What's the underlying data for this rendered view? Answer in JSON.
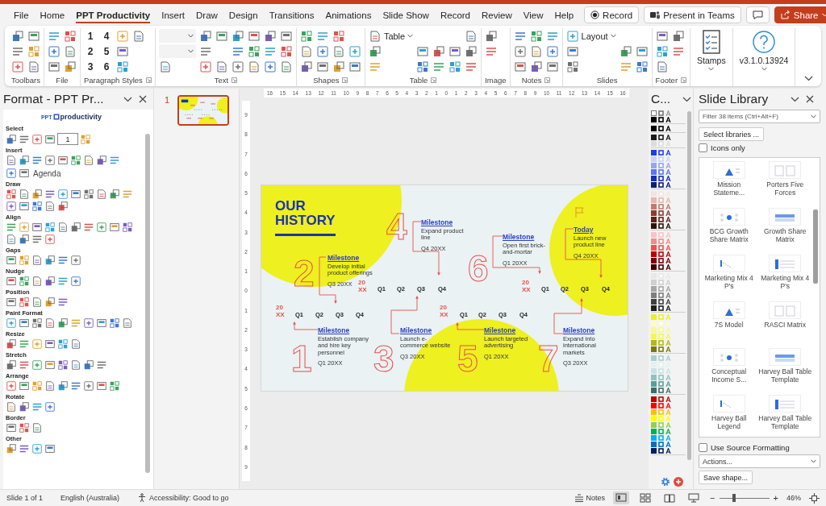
{
  "menu": {
    "tabs": [
      {
        "label": "File",
        "selected": false
      },
      {
        "label": "Home",
        "selected": false
      },
      {
        "label": "PPT Productivity",
        "selected": true
      },
      {
        "label": "Insert",
        "selected": false
      },
      {
        "label": "Draw",
        "selected": false
      },
      {
        "label": "Design",
        "selected": false
      },
      {
        "label": "Transitions",
        "selected": false
      },
      {
        "label": "Animations",
        "selected": false
      },
      {
        "label": "Slide Show",
        "selected": false
      },
      {
        "label": "Record",
        "selected": false
      },
      {
        "label": "Review",
        "selected": false
      },
      {
        "label": "View",
        "selected": false
      },
      {
        "label": "Help",
        "selected": false
      }
    ],
    "record": "Record",
    "present": "Present in Teams",
    "share": "Share"
  },
  "ribbon": {
    "groups": [
      {
        "label": "Toolbars",
        "launcher": false
      },
      {
        "label": "File",
        "launcher": false
      },
      {
        "label": "Paragraph Styles",
        "launcher": true,
        "texts": [
          "1",
          "2",
          "3",
          "4",
          "5",
          "6"
        ]
      },
      {
        "label": "Text",
        "launcher": true
      },
      {
        "label": "Shapes",
        "launcher": true
      },
      {
        "label": "Table",
        "launcher": true,
        "texts": [
          "Table"
        ]
      },
      {
        "label": "Image",
        "launcher": false
      },
      {
        "label": "Notes",
        "launcher": true
      },
      {
        "label": "Slides",
        "launcher": false,
        "texts": [
          "Layout"
        ]
      },
      {
        "label": "Footer",
        "launcher": true
      }
    ],
    "big_buttons": [
      {
        "label": "Stamps"
      },
      {
        "label": "v3.1.0.13924"
      }
    ]
  },
  "format_pane": {
    "title": "Format - PPT Pr...",
    "logo_badge": "PPT",
    "logo_text": "productivity",
    "sections": [
      {
        "title": "Select",
        "field": "1"
      },
      {
        "title": "Insert",
        "label": "Agenda"
      },
      {
        "title": "Draw"
      },
      {
        "title": "Align"
      },
      {
        "title": "Gaps"
      },
      {
        "title": "Nudge"
      },
      {
        "title": "Position"
      },
      {
        "title": "Paint Format"
      },
      {
        "title": "Resize"
      },
      {
        "title": "Stretch"
      },
      {
        "title": "Arrange"
      },
      {
        "title": "Rotate"
      },
      {
        "title": "Border"
      },
      {
        "title": "Other"
      }
    ]
  },
  "thumbnails": [
    {
      "number": "1",
      "selected": true
    }
  ],
  "rulers": {
    "horizontal": [
      "16",
      "15",
      "14",
      "13",
      "12",
      "11",
      "10",
      "9",
      "8",
      "7",
      "6",
      "5",
      "4",
      "3",
      "2",
      "1",
      "0",
      "1",
      "2",
      "3",
      "4",
      "5",
      "6",
      "7",
      "8",
      "9",
      "10",
      "11",
      "12",
      "13",
      "14",
      "15",
      "16"
    ],
    "vertical": [
      "9",
      "8",
      "7",
      "6",
      "5",
      "4",
      "3",
      "2",
      "1",
      "0",
      "1",
      "2",
      "3",
      "4",
      "5",
      "6",
      "7",
      "8",
      "9"
    ]
  },
  "slide": {
    "title": "OUR HISTORY",
    "timelines": [
      {
        "year": "20\nXX",
        "quarters": [
          "Q1",
          "Q2",
          "Q3",
          "Q4"
        ]
      },
      {
        "year": "20\nXX",
        "quarters": [
          "Q1",
          "Q2",
          "Q3",
          "Q4"
        ]
      },
      {
        "year": "20\nXX",
        "quarters": [
          "Q1",
          "Q2",
          "Q3",
          "Q4"
        ]
      },
      {
        "year": "20\nXX",
        "quarters": [
          "Q1",
          "Q2",
          "Q3",
          "Q4"
        ]
      }
    ],
    "milestones": [
      {
        "number": "4",
        "title": "Milestone",
        "text": "Expand product line",
        "date": "Q4 20XX"
      },
      {
        "title": "Today",
        "text": "Launch new product line",
        "date": "Q4 20XX"
      },
      {
        "number": "6",
        "title": "Milestone",
        "text": "Open first brick-and-mortar",
        "date": "Q1 20XX"
      },
      {
        "number": "2",
        "title": "Milestone",
        "text": "Develop initial product offerings",
        "date": "Q3 20XX"
      },
      {
        "number": "1",
        "title": "Milestone",
        "text": "Establish company and hire key personnel",
        "date": "Q1 20XX"
      },
      {
        "number": "3",
        "title": "Milestone",
        "text": "Launch e-commerce website",
        "date": "Q3 20XX"
      },
      {
        "number": "5",
        "title": "Milestone",
        "text": "Launch targeted advertising",
        "date": "Q1 20XX"
      },
      {
        "number": "7",
        "title": "Milestone",
        "text": "Expand into international markets",
        "date": "Q3 20XX"
      }
    ]
  },
  "color_pane": {
    "title": "C...",
    "groups": [
      [
        {
          "color": "#ffffff"
        },
        {
          "color": "#000000"
        }
      ],
      [
        {
          "color": "#000000"
        }
      ],
      [
        {
          "color": "#1a1a1a"
        },
        {
          "color": "#dcdcdc"
        }
      ],
      [
        {
          "color": "#1f3ee0"
        },
        {
          "color": "#c9d3f8"
        },
        {
          "color": "#93a6f0"
        },
        {
          "color": "#5b76e8"
        },
        {
          "color": "#1530b0"
        },
        {
          "color": "#0d1f78"
        }
      ],
      [
        {
          "color": "#f3e4e0"
        },
        {
          "color": "#e2b8ae"
        },
        {
          "color": "#c47a6a"
        },
        {
          "color": "#8c3d2e"
        },
        {
          "color": "#5a2418"
        },
        {
          "color": "#2e120b"
        }
      ],
      [
        {
          "color": "#f8c4c4"
        },
        {
          "color": "#f48a8a"
        },
        {
          "color": "#ef5050"
        },
        {
          "color": "#c00000"
        },
        {
          "color": "#800000"
        },
        {
          "color": "#400000"
        }
      ],
      [
        {
          "color": "#e8e8e8"
        },
        {
          "color": "#cfcfcf"
        },
        {
          "color": "#a6a6a6"
        },
        {
          "color": "#7f7f7f"
        },
        {
          "color": "#404040"
        },
        {
          "color": "#1f1f1f"
        }
      ],
      [
        {
          "color": "#eef01f"
        },
        {
          "color": "#fbfcc8"
        },
        {
          "color": "#f8f98f"
        },
        {
          "color": "#f3f55a"
        },
        {
          "color": "#b5b716"
        },
        {
          "color": "#797a0f"
        }
      ],
      [
        {
          "color": "#a8d0cf"
        },
        {
          "color": "#e3f1f1"
        },
        {
          "color": "#c8e3e2"
        },
        {
          "color": "#8ec3c1"
        },
        {
          "color": "#5a9e9c"
        },
        {
          "color": "#3a6e6c"
        }
      ],
      [
        {
          "color": "#c00000"
        },
        {
          "color": "#ff0000"
        },
        {
          "color": "#ffc000"
        },
        {
          "color": "#ffff00"
        },
        {
          "color": "#92d050"
        },
        {
          "color": "#00b050"
        },
        {
          "color": "#00b0f0"
        },
        {
          "color": "#0070c0"
        },
        {
          "color": "#002060"
        }
      ]
    ]
  },
  "slide_library": {
    "title": "Slide Library",
    "filter_placeholder": "Filter 38 items (Ctrl+Alt+F)",
    "select_button": "Select libraries ...",
    "icons_only": {
      "label": "Icons only",
      "checked": false
    },
    "items": [
      "Mission Stateme...",
      "Porters Five Forces",
      "BCG Growth Share Matrix",
      "Growth Share Matrix",
      "Marketing Mix 4 P's",
      "Marketing Mix 4 P's",
      "7S Model",
      "RASCI Matrix",
      "Conceptual Income S...",
      "Harvey Ball Table Template",
      "Harvey Ball Legend",
      "Harvey Ball Table Template"
    ],
    "source_formatting": {
      "label": "Use Source Formatting",
      "checked": false
    },
    "actions": "Actions...",
    "save_button": "Save shape..."
  },
  "status_bar": {
    "slide": "Slide 1 of 1",
    "language": "English (Australia)",
    "accessibility": "Accessibility: Good to go",
    "notes": "Notes",
    "views": [
      {
        "selected": true
      },
      {
        "selected": false
      },
      {
        "selected": false
      },
      {
        "selected": false
      }
    ],
    "zoom": {
      "minus": "−",
      "plus": "+",
      "level": 0.3,
      "percent": "46%"
    }
  }
}
